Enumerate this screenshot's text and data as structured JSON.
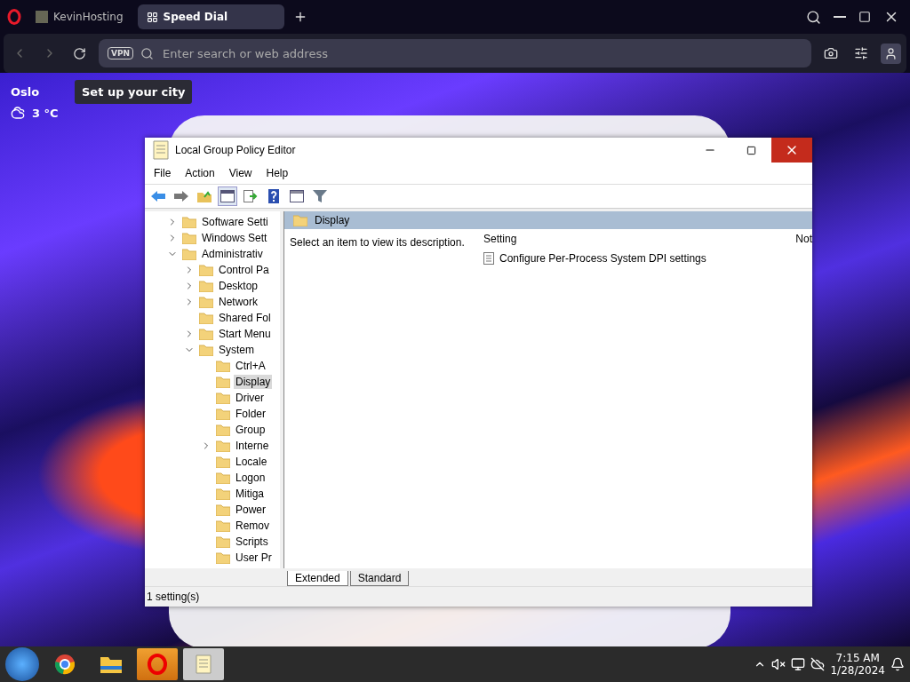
{
  "browser": {
    "tabs": [
      {
        "label": "KevinHosting",
        "selected": false
      },
      {
        "label": "Speed Dial",
        "selected": true
      }
    ],
    "address": {
      "badge": "VPN",
      "placeholder": "Enter search or web address"
    }
  },
  "weather": {
    "city": "Oslo",
    "temperature": "3 °C",
    "tooltip": "Set up your city"
  },
  "window": {
    "title": "Local Group Policy Editor",
    "menu": [
      "File",
      "Action",
      "View",
      "Help"
    ],
    "toolbar": [
      {
        "kind": "back",
        "pressed": false
      },
      {
        "kind": "forward",
        "pressed": false
      },
      {
        "kind": "up",
        "pressed": false
      },
      {
        "kind": "tree",
        "pressed": true
      },
      {
        "kind": "export",
        "pressed": false
      },
      {
        "kind": "help",
        "pressed": false
      },
      {
        "kind": "properties",
        "pressed": false
      },
      {
        "kind": "filter",
        "pressed": false
      }
    ],
    "tree": [
      {
        "label": "Software Setti",
        "kind": "branch",
        "expanded": false,
        "selected": false
      },
      {
        "label": "Windows Sett",
        "kind": "branch",
        "expanded": false,
        "selected": false
      },
      {
        "label": "Administrativ",
        "kind": "branch",
        "expanded": true,
        "selected": false,
        "children": [
          {
            "label": "Control Pa",
            "kind": "branch",
            "expanded": false,
            "selected": false
          },
          {
            "label": "Desktop",
            "kind": "branch",
            "expanded": false,
            "selected": false
          },
          {
            "label": "Network",
            "kind": "branch",
            "expanded": false,
            "selected": false
          },
          {
            "label": "Shared Fol",
            "kind": "leaf",
            "selected": false
          },
          {
            "label": "Start Menu",
            "kind": "branch",
            "expanded": false,
            "selected": false
          },
          {
            "label": "System",
            "kind": "branch",
            "expanded": true,
            "selected": false,
            "children": [
              {
                "label": "Ctrl+A",
                "kind": "leaf",
                "selected": false
              },
              {
                "label": "Display",
                "kind": "leaf",
                "selected": true
              },
              {
                "label": "Driver",
                "kind": "leaf",
                "selected": false
              },
              {
                "label": "Folder",
                "kind": "leaf",
                "selected": false
              },
              {
                "label": "Group",
                "kind": "leaf",
                "selected": false
              },
              {
                "label": "Interne",
                "kind": "branch",
                "expanded": false,
                "selected": false
              },
              {
                "label": "Locale",
                "kind": "leaf",
                "selected": false
              },
              {
                "label": "Logon",
                "kind": "leaf",
                "selected": false
              },
              {
                "label": "Mitiga",
                "kind": "leaf",
                "selected": false
              },
              {
                "label": "Power",
                "kind": "leaf",
                "selected": false
              },
              {
                "label": "Remov",
                "kind": "leaf",
                "selected": false
              },
              {
                "label": "Scripts",
                "kind": "leaf",
                "selected": false
              },
              {
                "label": "User Pr",
                "kind": "leaf",
                "selected": false
              }
            ]
          }
        ]
      }
    ],
    "pane": {
      "heading": "Display",
      "description": "Select an item to view its description.",
      "columns": [
        "Setting",
        "Not"
      ],
      "rows": [
        {
          "setting": "Configure Per-Process System DPI settings"
        }
      ]
    },
    "view_tabs": [
      {
        "label": "Extended",
        "selected": true
      },
      {
        "label": "Standard",
        "selected": false
      }
    ],
    "status_bar": "1 setting(s)"
  },
  "taskbar": {
    "apps": [
      {
        "kind": "chrome",
        "active": false
      },
      {
        "kind": "explorer",
        "active": false
      },
      {
        "kind": "opera",
        "active": true
      },
      {
        "kind": "policy",
        "active": true
      }
    ],
    "time": "7:15 AM",
    "date": "1/28/2024"
  }
}
